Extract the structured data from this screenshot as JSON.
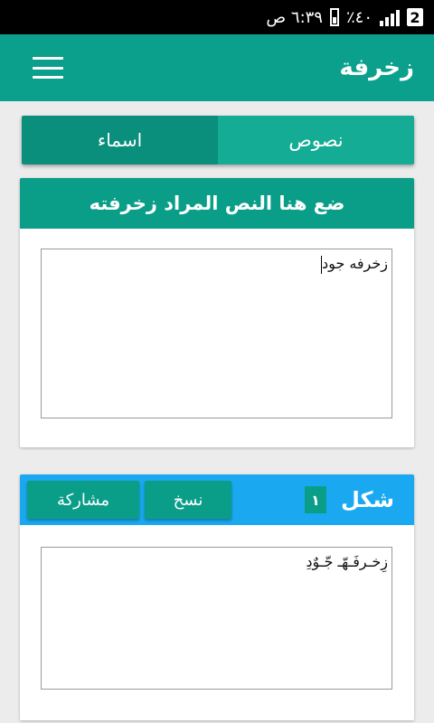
{
  "status_bar": {
    "time": "٦:٣٩ ص",
    "battery_percent": "٪٤٠",
    "sim_badge": "2"
  },
  "app_bar": {
    "title": "زخرفة",
    "menu_icon": "hamburger-menu-icon"
  },
  "tabs": [
    {
      "label": "اسماء",
      "selected": false
    },
    {
      "label": "نصوص",
      "selected": true
    }
  ],
  "input_card": {
    "header": "ضع هنا النص المراد زخرفته",
    "input_value": "زخرفه جود"
  },
  "result_card": {
    "shape_label": "شكل",
    "shape_number": "١",
    "copy_button": "نسخ",
    "share_button": "مشاركة",
    "result_text": "زِخـرفَـهّـ جّـوٌدِ"
  },
  "colors": {
    "primary": "#0aa08c",
    "primary_dark": "#0a8f7d",
    "accent_blue": "#1aa9f0"
  }
}
